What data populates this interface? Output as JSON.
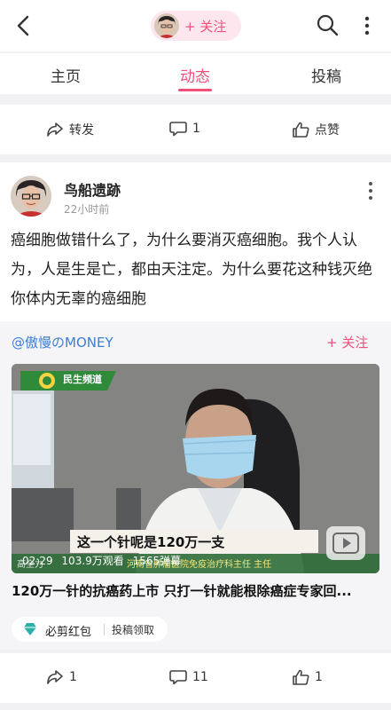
{
  "header": {
    "follow_label": "+ 关注"
  },
  "tabs": [
    "主页",
    "动态",
    "投稿"
  ],
  "prev_post_actions": {
    "share": "转发",
    "comments": "1",
    "like": "点赞"
  },
  "post": {
    "author": "鸟船遗跡",
    "time": "22小时前",
    "text": "癌细胞做错什么了，为什么要消灭癌细胞。我个人认为，人是生是亡，都由天注定。为什么要花这种钱灭绝你体内无辜的癌细胞",
    "repost": {
      "handle": "@傲慢のMONEY",
      "follow_label": "+ 关注",
      "video": {
        "channel": "民生频道",
        "caption": "这一个针呢是120万一支",
        "speaker": "高全力",
        "org": "河南省肿瘤医院免疫治疗科主任 主任",
        "duration": "02:29",
        "views": "103.9万观看",
        "danmaku": "1565弹幕"
      },
      "title": "120万一针的抗癌药上市 只打一针就能根除癌症专家回...",
      "chip": {
        "label": "必剪红包",
        "sub": "投稿领取"
      }
    },
    "actions": {
      "share": "1",
      "comments": "11",
      "likes": "1"
    }
  },
  "colors": {
    "accent": "#f2507b",
    "link": "#3b7fd4",
    "background": "#f1f1f3"
  }
}
